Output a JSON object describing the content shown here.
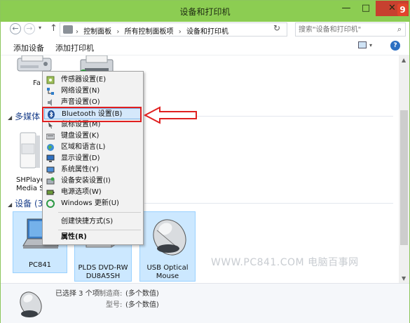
{
  "window": {
    "title": "设备和打印机",
    "controls": {
      "minimize": "—",
      "maximize": "□",
      "close": "✕"
    },
    "logo_mark": "9"
  },
  "nav": {
    "back": "←",
    "forward": "→",
    "history": "▾",
    "up": "↑",
    "breadcrumbs": [
      "控制面板",
      "所有控制面板项",
      "设备和打印机"
    ],
    "crumb_separator": "›",
    "dropdown": "▾",
    "refresh": "↻",
    "search_placeholder": "搜索\"设备和打印机\"",
    "search_icon": "⌕"
  },
  "command_bar": {
    "add_device": "添加设备",
    "add_printer": "添加打印机",
    "view_drop": "▾",
    "help": "?"
  },
  "content": {
    "fax_label": "Fa",
    "multimedia_group": "多媒体",
    "devices_group": "设备 (3)",
    "group_toggle": "◢",
    "shplayer_label_1": "SHPlaye",
    "shplayer_label_2": "Media S",
    "devices": [
      {
        "label": "PC841"
      },
      {
        "label_1": "PLDS DVD-RW",
        "label_2": "DU8A5SH"
      },
      {
        "label_1": "USB Optical",
        "label_2": "Mouse"
      }
    ],
    "watermark": "WWW.PC841.COM 电脑百事网"
  },
  "context_menu": {
    "items": [
      {
        "label": "传感器设置(E)",
        "icon": "sensor-icon"
      },
      {
        "label": "网络设置(N)",
        "icon": "network-icon"
      },
      {
        "label": "声音设置(O)",
        "icon": "sound-icon"
      },
      {
        "label": "Bluetooth 设置(B)",
        "icon": "bluetooth-icon"
      },
      {
        "label": "鼠标设置(M)",
        "icon": "mouse-icon"
      },
      {
        "label": "键盘设置(K)",
        "icon": "keyboard-icon"
      },
      {
        "label": "区域和语言(L)",
        "icon": "region-icon"
      },
      {
        "label": "显示设置(D)",
        "icon": "display-icon"
      },
      {
        "label": "系统属性(Y)",
        "icon": "system-icon"
      },
      {
        "label": "设备安装设置(I)",
        "icon": "device-install-icon"
      },
      {
        "label": "电源选项(W)",
        "icon": "power-icon"
      },
      {
        "label": "Windows 更新(U)",
        "icon": "windows-update-icon"
      },
      {
        "label": "创建快捷方式(S)",
        "icon": ""
      },
      {
        "label": "属性(R)",
        "icon": ""
      }
    ],
    "highlighted_index": 3
  },
  "details": {
    "selected": "已选择 3 个项",
    "manufacturer_label": "制造商:",
    "manufacturer_value": "(多个数值)",
    "model_label": "型号:",
    "model_value": "(多个数值)"
  },
  "scrollbar": {
    "up": "▲",
    "down": "▼"
  },
  "colors": {
    "titlebar": "#8ccd52",
    "close": "#c7402f",
    "selection_bg": "#cce8ff",
    "annotation_red": "#e02020"
  }
}
